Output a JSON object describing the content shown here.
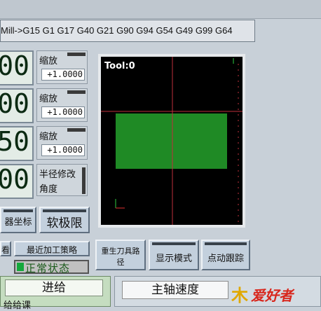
{
  "gcode_line": "Mill->G15  G1 G17 G40 G21 G90 G94 G54 G49 G99 G64",
  "dro": [
    {
      "value": "00",
      "scale_label": "缩放",
      "scale_value": "+1.0000"
    },
    {
      "value": "00",
      "scale_label": "缩放",
      "scale_value": "+1.0000"
    },
    {
      "value": "50",
      "scale_label": "缩放",
      "scale_value": "+1.0000"
    },
    {
      "value": "00"
    }
  ],
  "radius_box": {
    "line1": "半径修改",
    "line2": "角度"
  },
  "buttons": {
    "machine_coords": "器坐标",
    "soft_limits": "软极限",
    "left_partial": "看",
    "recent_strategy": "最近加工策略",
    "regen_toolpath_l1": "重生刀具路",
    "regen_toolpath_l2": "径",
    "display_mode": "显示模式",
    "jog_follow": "点动跟踪"
  },
  "viewport": {
    "tool_label": "Tool:0",
    "colors": {
      "stock": "#1f8a25",
      "crosshair": "#c0303c",
      "axis_y": "#2ecc40",
      "axis_x": "#e03030"
    }
  },
  "status": {
    "text": "正常状态",
    "led_color": "#14a83c"
  },
  "feed": {
    "title": "进给",
    "sub_text": "给给课"
  },
  "spindle": {
    "title": "主轴速度"
  },
  "logo": {
    "text": "爱好者",
    "mark": "木"
  }
}
